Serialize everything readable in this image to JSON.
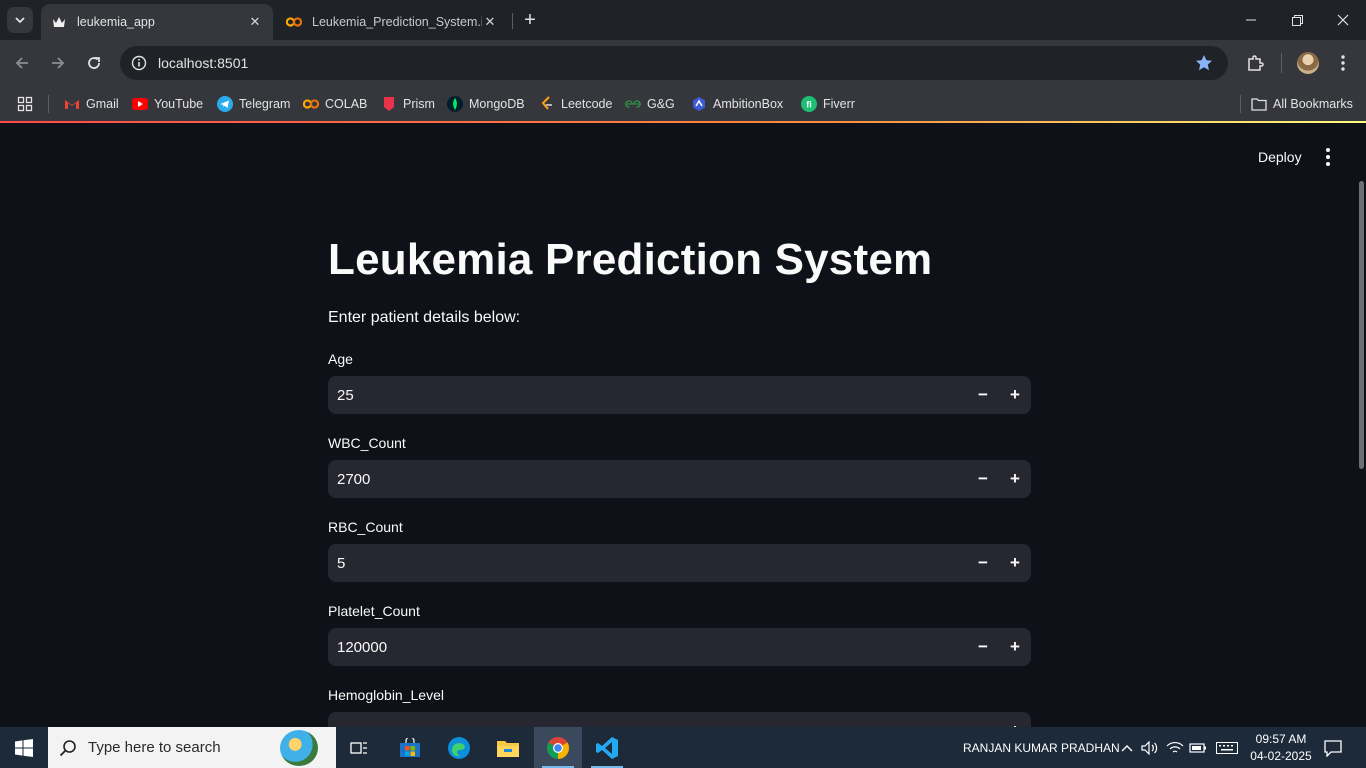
{
  "browser": {
    "tabs": [
      {
        "title": "leukemia_app",
        "active": true,
        "favicon": "streamlit-crown-icon"
      },
      {
        "title": "Leukemia_Prediction_System.ipynb",
        "active": false,
        "favicon": "colab-icon"
      }
    ],
    "url": "localhost:8501",
    "bookmarks": [
      {
        "label": "Gmail",
        "icon": "gmail-icon"
      },
      {
        "label": "YouTube",
        "icon": "youtube-icon"
      },
      {
        "label": "Telegram",
        "icon": "telegram-icon"
      },
      {
        "label": "COLAB",
        "icon": "colab-icon"
      },
      {
        "label": "Prism",
        "icon": "prism-icon"
      },
      {
        "label": "MongoDB",
        "icon": "mongodb-icon"
      },
      {
        "label": "Leetcode",
        "icon": "leetcode-icon"
      },
      {
        "label": "G&G",
        "icon": "gfg-icon"
      },
      {
        "label": "AmbitionBox",
        "icon": "ambitionbox-icon"
      },
      {
        "label": "Fiverr",
        "icon": "fiverr-icon"
      }
    ],
    "all_bookmarks_label": "All Bookmarks"
  },
  "app": {
    "deploy_label": "Deploy",
    "title": "Leukemia Prediction System",
    "subtitle": "Enter patient details below:",
    "fields": [
      {
        "label": "Age",
        "value": "25"
      },
      {
        "label": "WBC_Count",
        "value": "2700"
      },
      {
        "label": "RBC_Count",
        "value": "5"
      },
      {
        "label": "Platelet_Count",
        "value": "120000"
      },
      {
        "label": "Hemoglobin_Level",
        "value": ""
      }
    ],
    "minus_symbol": "−",
    "plus_symbol": "+"
  },
  "taskbar": {
    "search_placeholder": "Type here to search",
    "user_name": "RANJAN KUMAR PRADHAN",
    "time": "09:57 AM",
    "date": "04-02-2025"
  },
  "colors": {
    "accent": "#ff4b4b",
    "app_background": "#0e1117",
    "input_background": "#262730"
  }
}
